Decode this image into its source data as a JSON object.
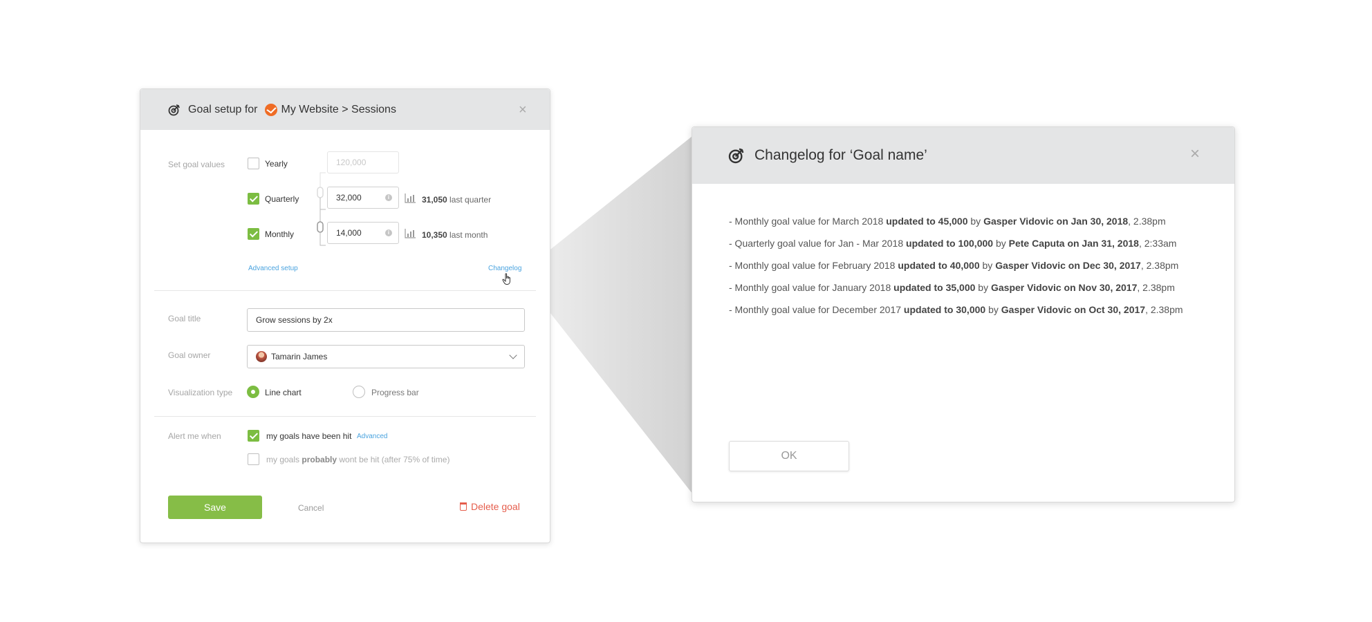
{
  "goal_dialog": {
    "title_prefix": "Goal setup for",
    "site_name": "My Website > Sessions",
    "close_glyph": "×",
    "goal_values": {
      "label": "Set goal values",
      "yearly": {
        "label": "Yearly",
        "checked": false,
        "value": "120,000"
      },
      "quarterly": {
        "label": "Quarterly",
        "checked": true,
        "value": "32,000",
        "stat_value": "31,050",
        "stat_text": "last quarter"
      },
      "monthly": {
        "label": "Monthly",
        "checked": true,
        "value": "14,000",
        "stat_value": "10,350",
        "stat_text": "last month"
      },
      "advanced_setup_link": "Advanced setup",
      "changelog_link": "Changelog"
    },
    "goal_title": {
      "label": "Goal title",
      "value": "Grow sessions by 2x"
    },
    "goal_owner": {
      "label": "Goal owner",
      "value": "Tamarin James"
    },
    "visualization": {
      "label": "Visualization type",
      "options": [
        {
          "label": "Line chart",
          "selected": true
        },
        {
          "label": "Progress bar",
          "selected": false
        }
      ]
    },
    "alerts": {
      "label": "Alert me when",
      "hit": {
        "text": "my goals have been hit",
        "checked": true,
        "advanced_link": "Advanced"
      },
      "probably_prefix": "my goals",
      "probably_bold": "probably",
      "probably_suffix": "wont be hit (after 75% of time)",
      "probably_checked": false
    },
    "buttons": {
      "save": "Save",
      "cancel": "Cancel",
      "delete": "Delete goal"
    }
  },
  "changelog_dialog": {
    "title": "Changelog for ‘Goal name’",
    "close_glyph": "×",
    "entries": [
      {
        "prefix": "- Monthly goal value for March 2018",
        "update": "updated to 45,000",
        "by": "by",
        "who": "Gasper Vidovic on Jan 30, 2018",
        "time": ", 2.38pm"
      },
      {
        "prefix": "- Quarterly goal value for Jan - Mar 2018",
        "update": "updated to 100,000",
        "by": "by",
        "who": "Pete Caputa on Jan 31, 2018",
        "time": ", 2:33am"
      },
      {
        "prefix": "- Monthly goal value for February 2018",
        "update": "updated to 40,000",
        "by": "by",
        "who": "Gasper Vidovic on Dec 30, 2017",
        "time": ", 2.38pm"
      },
      {
        "prefix": "- Monthly goal value for January 2018",
        "update": "updated to 35,000",
        "by": "by",
        "who": "Gasper Vidovic on Nov 30, 2017",
        "time": ", 2.38pm"
      },
      {
        "prefix": "- Monthly goal value for December 2017",
        "update": "updated to 30,000",
        "by": "by",
        "who": "Gasper Vidovic on Oct 30, 2017",
        "time": ", 2.38pm"
      }
    ],
    "ok_button": "OK"
  }
}
